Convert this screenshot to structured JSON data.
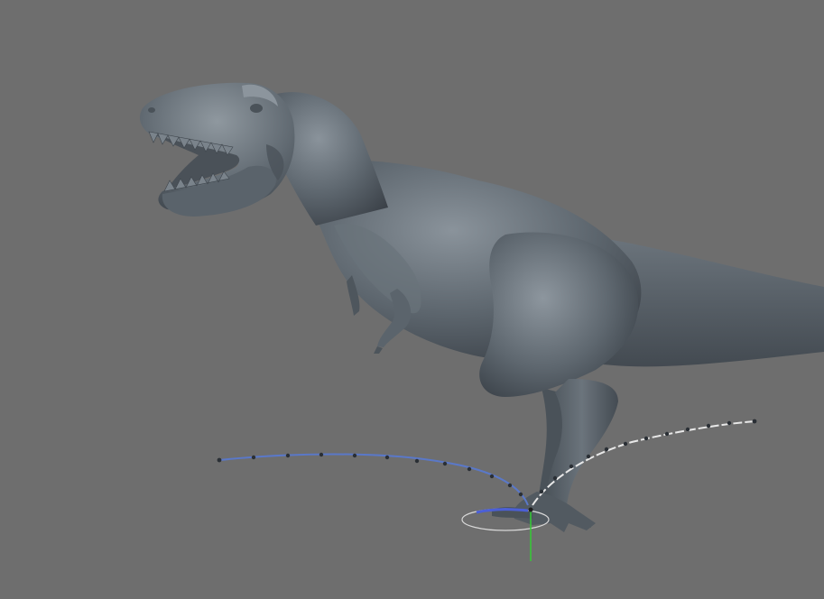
{
  "viewport": {
    "background": "#6e6e6e",
    "model_color": "#5a636b"
  },
  "model": {
    "icon": "dinosaur-mesh-icon"
  },
  "motion_paths": [
    {
      "icon": "motion-path-curve-icon",
      "color": "#5a78c8"
    },
    {
      "icon": "motion-path-curve-icon",
      "color": "#e8e8e8"
    }
  ],
  "gizmo": {
    "icon": "transform-gizmo-icon",
    "axis_colors": {
      "y": "#33cc33",
      "ring": "#d8d8d8"
    }
  }
}
